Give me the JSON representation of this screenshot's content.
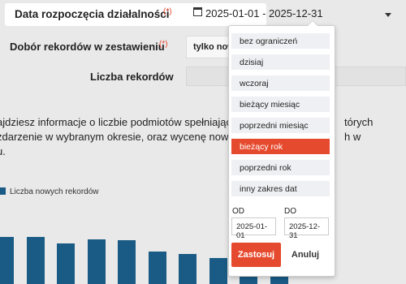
{
  "filters": {
    "date_label": "Data rozpoczęcia działalności",
    "date_required": "(*)",
    "date_range_value": "2025-01-01 - 2025-12-31",
    "selection_label": "Dobór rekordów w zestawieniu",
    "selection_required": "(*)",
    "selection_value": "tylko nowe",
    "count_label": "Liczba rekordów",
    "count_value": ""
  },
  "description": {
    "line1": "ajdziesz informacje o liczbie podmiotów spełniającyc",
    "line2": "zdarzenie w wybranym okresie, oraz wycenę nowych",
    "line3": "u.",
    "right1": "tórych",
    "right2": "h w"
  },
  "chart_data": {
    "type": "bar",
    "legend": "Liczba nowych rekordów",
    "series": [
      {
        "name": "Liczba nowych rekordów",
        "values": [
          58,
          58,
          50,
          55,
          54,
          40,
          37,
          32,
          27,
          24
        ]
      }
    ],
    "colors": {
      "bar": "#1a5b85"
    }
  },
  "daterange_picker": {
    "ranges": [
      "bez ograniczeń",
      "dzisiaj",
      "wczoraj",
      "bieżący miesiąc",
      "poprzedni miesiąc",
      "bieżący rok",
      "poprzedni rok",
      "inny zakres dat"
    ],
    "active_range": "bieżący rok",
    "from_label": "OD",
    "to_label": "DO",
    "from_value": "2025-01-01",
    "to_value": "2025-12-31",
    "apply_label": "Zastosuj",
    "cancel_label": "Anuluj"
  },
  "colors": {
    "accent": "#e64a2e",
    "bar": "#1a5b85"
  }
}
